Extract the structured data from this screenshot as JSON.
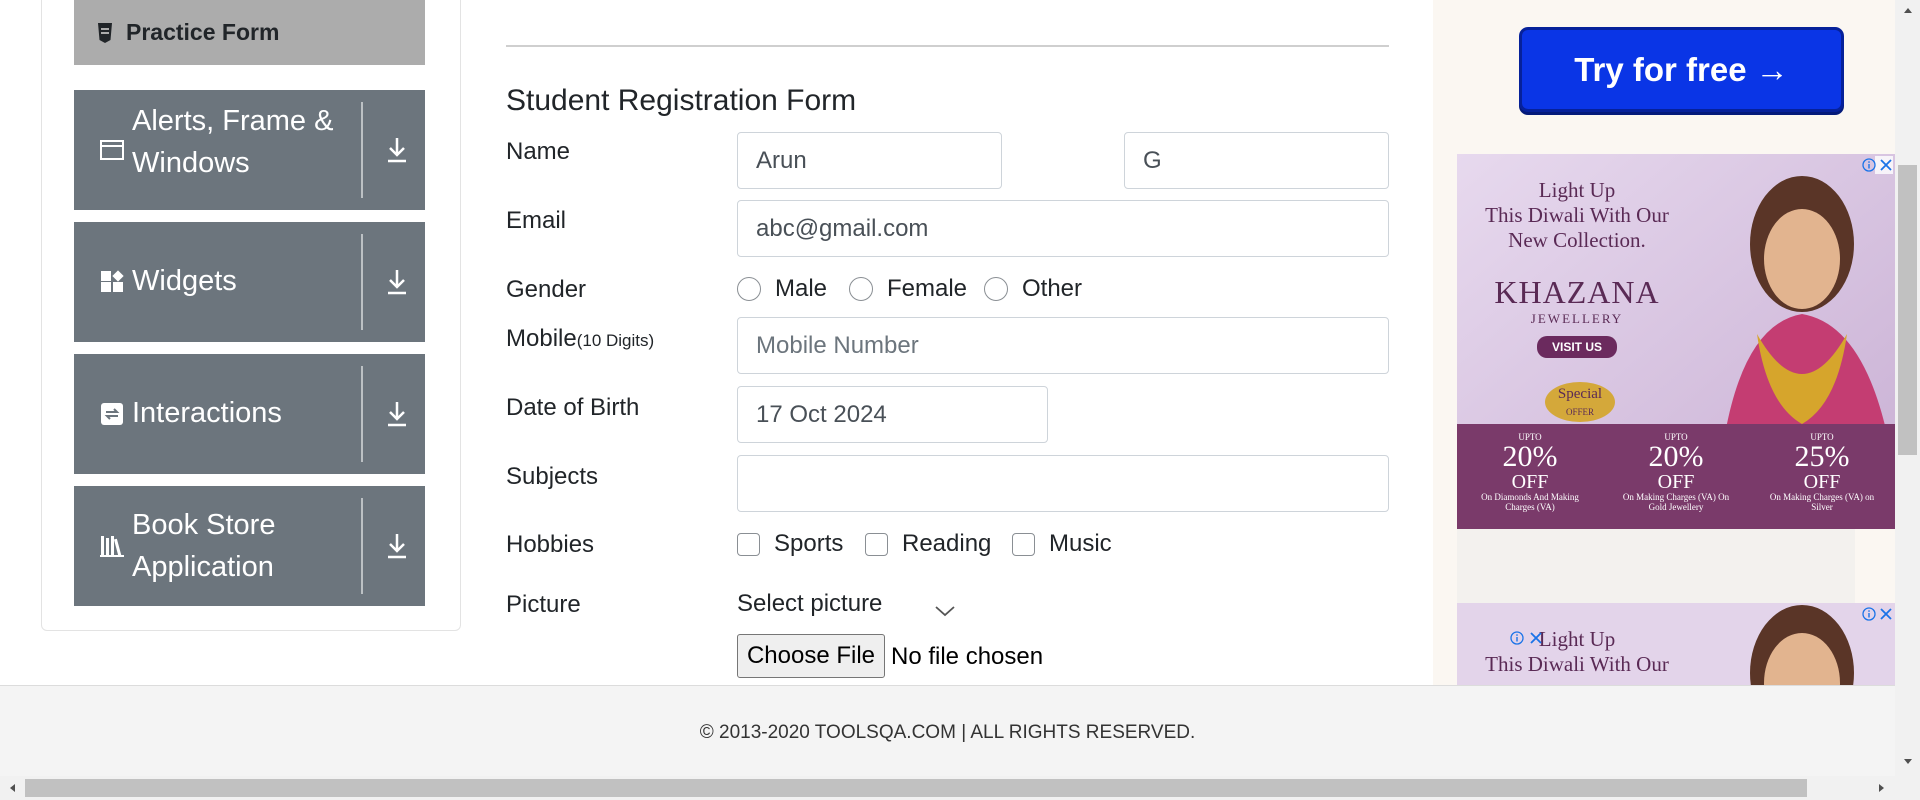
{
  "sidebar": {
    "practice_form": "Practice Form",
    "groups": [
      {
        "label": "Alerts, Frame & Windows",
        "icon": "window-icon"
      },
      {
        "label": "Widgets",
        "icon": "widgets-icon"
      },
      {
        "label": "Interactions",
        "icon": "interactions-icon"
      },
      {
        "label": "Book Store Application",
        "icon": "books-icon"
      }
    ]
  },
  "form": {
    "title": "Student Registration Form",
    "name_label": "Name",
    "first_name_value": "Arun",
    "last_name_value": "G",
    "email_label": "Email",
    "email_value": "abc@gmail.com",
    "gender_label": "Gender",
    "gender_options": [
      "Male",
      "Female",
      "Other"
    ],
    "mobile_label": "Mobile",
    "mobile_hint": "(10 Digits)",
    "mobile_placeholder": "Mobile Number",
    "dob_label": "Date of Birth",
    "dob_value": "17 Oct 2024",
    "subjects_label": "Subjects",
    "subjects_value": "",
    "hobbies_label": "Hobbies",
    "hobbies_options": [
      "Sports",
      "Reading",
      "Music"
    ],
    "picture_label": "Picture",
    "select_picture": "Select picture",
    "choose_file_label": "Choose File",
    "no_file_text": "No file chosen"
  },
  "ads": {
    "try_button": "Try for free →",
    "banner": {
      "headline_line1": "Light Up",
      "headline_line2": "This Diwali With Our",
      "headline_line3": "New Collection.",
      "brand": "KHAZANA",
      "brand_sub": "JEWELLERY",
      "visit": "VISIT US",
      "special": "Special",
      "offer": "OFFER",
      "deal1_pct": "20%",
      "deal1_text": "On Diamonds And Making Charges (VA)",
      "deal2_pct": "20%",
      "deal2_text": "On Making Charges (VA) On Gold Jewellery",
      "deal3_pct": "25%",
      "deal3_text": "On Making Charges (VA) on Silver",
      "upto": "UPTO",
      "off": "OFF"
    },
    "banner2": {
      "headline_line1": "Light Up",
      "headline_line2": "This Diwali With Our"
    }
  },
  "footer": {
    "text": "© 2013-2020 TOOLSQA.COM | ALL RIGHTS RESERVED."
  },
  "colors": {
    "sidebar_group_bg": "#6c757d",
    "practice_bg": "#acacac",
    "try_button_bg": "#0a35e6",
    "ad_purple": "#7a3a6a"
  }
}
